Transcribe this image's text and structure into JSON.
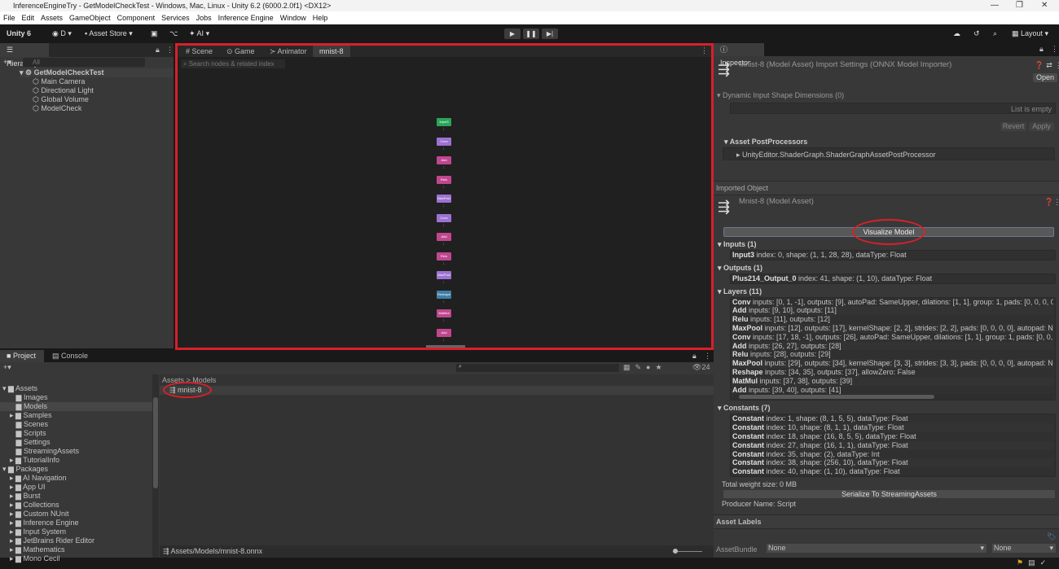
{
  "window": {
    "title": "InferenceEngineTry - GetModelCheckTest - Windows, Mac, Linux - Unity 6.2 (6000.2.0f1) <DX12>"
  },
  "menu": [
    "File",
    "Edit",
    "Assets",
    "GameObject",
    "Component",
    "Services",
    "Jobs",
    "Inference Engine",
    "Window",
    "Help"
  ],
  "toolbar": {
    "unity": "Unity 6",
    "account": "D",
    "asset_store": "Asset Store",
    "ai": "AI",
    "layout": "Layout"
  },
  "hierarchy": {
    "tab": "Hierarchy",
    "search_placeholder": "All",
    "scene": "GetModelCheckTest",
    "objects": [
      "Main Camera",
      "Directional Light",
      "Global Volume",
      "ModelCheck"
    ]
  },
  "center": {
    "tabs": [
      "Scene",
      "Game",
      "Animator",
      "mnist-8"
    ],
    "search_placeholder": "Search nodes & related index",
    "nodes": [
      {
        "label": "Input3",
        "type": "input"
      },
      {
        "label": "Conv",
        "type": "conv"
      },
      {
        "label": "Add",
        "type": "op"
      },
      {
        "label": "Relu",
        "type": "op"
      },
      {
        "label": "MaxPool",
        "type": "conv"
      },
      {
        "label": "Conv",
        "type": "conv"
      },
      {
        "label": "Add",
        "type": "op"
      },
      {
        "label": "Relu",
        "type": "op"
      },
      {
        "label": "MaxPool",
        "type": "conv"
      },
      {
        "label": "Reshape",
        "type": "reshape"
      },
      {
        "label": "MatMul",
        "type": "op"
      },
      {
        "label": "Add",
        "type": "op"
      }
    ],
    "node_colors": {
      "input": "#2aa55a",
      "conv": "#9c72d2",
      "op": "#c0468f",
      "reshape": "#3e7ea6"
    }
  },
  "project": {
    "tabs": [
      "Project",
      "Console"
    ],
    "assets_label": "Assets",
    "asset_folders": [
      "Images",
      "Models",
      "Samples",
      "Scenes",
      "Scripts",
      "Settings",
      "StreamingAssets",
      "TutorialInfo"
    ],
    "packages_label": "Packages",
    "packages": [
      "AI Navigation",
      "App UI",
      "Burst",
      "Collections",
      "Custom NUnit",
      "Inference Engine",
      "Input System",
      "JetBrains Rider Editor",
      "Mathematics",
      "Mono Cecil"
    ],
    "breadcrumb": "Assets > Models",
    "file": "mnist-8",
    "path": "Assets/Models/mnist-8.onnx",
    "count": "24"
  },
  "inspector": {
    "tab": "Inspector",
    "title": "Mnist-8 (Model Asset) Import Settings (ONNX Model Importer)",
    "open": "Open",
    "dynamic": "Dynamic Input Shape Dimensions (0)",
    "list_empty": "List is empty",
    "revert": "Revert",
    "apply": "Apply",
    "postprocessors": "Asset PostProcessors",
    "postprocessor_item": "UnityEditor.ShaderGraph.ShaderGraphAssetPostProcessor",
    "imported": "Imported Object",
    "asset_title": "Mnist-8 (Model Asset)",
    "visualize": "Visualize Model",
    "inputs_hdr": "Inputs (1)",
    "inputs": [
      {
        "name": "Input3",
        "desc": " index: 0, shape: (1, 1, 28, 28), dataType: Float"
      }
    ],
    "outputs_hdr": "Outputs (1)",
    "outputs": [
      {
        "name": "Plus214_Output_0",
        "desc": " index: 41, shape: (1, 10), dataType: Float"
      }
    ],
    "layers_hdr": "Layers (11)",
    "layers": [
      {
        "name": "Conv",
        "desc": " inputs: [0, 1, -1], outputs: [9], autoPad: SameUpper, dilations: [1, 1], group: 1, pads: [0, 0, 0, 0, 0, 0,"
      },
      {
        "name": "Add",
        "desc": " inputs: [9, 10], outputs: [11]"
      },
      {
        "name": "Relu",
        "desc": " inputs: [11], outputs: [12]"
      },
      {
        "name": "MaxPool",
        "desc": " inputs: [12], outputs: [17], kernelShape: [2, 2], strides: [2, 2], pads: [0, 0, 0, 0], autopad: NotSet"
      },
      {
        "name": "Conv",
        "desc": " inputs: [17, 18, -1], outputs: [26], autoPad: SameUpper, dilations: [1, 1], group: 1, pads: [0, 0, 0, 0, 0"
      },
      {
        "name": "Add",
        "desc": " inputs: [26, 27], outputs: [28]"
      },
      {
        "name": "Relu",
        "desc": " inputs: [28], outputs: [29]"
      },
      {
        "name": "MaxPool",
        "desc": " inputs: [29], outputs: [34], kernelShape: [3, 3], strides: [3, 3], pads: [0, 0, 0, 0], autopad: NotSet"
      },
      {
        "name": "Reshape",
        "desc": " inputs: [34, 35], outputs: [37], allowZero: False"
      },
      {
        "name": "MatMul",
        "desc": " inputs: [37, 38], outputs: [39]"
      },
      {
        "name": "Add",
        "desc": " inputs: [39, 40], outputs: [41]"
      }
    ],
    "constants_hdr": "Constants (7)",
    "constants": [
      {
        "name": "Constant",
        "desc": " index: 1, shape: (8, 1, 5, 5), dataType: Float"
      },
      {
        "name": "Constant",
        "desc": " index: 10, shape: (8, 1, 1), dataType: Float"
      },
      {
        "name": "Constant",
        "desc": " index: 18, shape: (16, 8, 5, 5), dataType: Float"
      },
      {
        "name": "Constant",
        "desc": " index: 27, shape: (16, 1, 1), dataType: Float"
      },
      {
        "name": "Constant",
        "desc": " index: 35, shape: (2), dataType: Int"
      },
      {
        "name": "Constant",
        "desc": " index: 38, shape: (256, 10), dataType: Float"
      },
      {
        "name": "Constant",
        "desc": " index: 40, shape: (1, 10), dataType: Float"
      }
    ],
    "weight": "Total weight size: 0 MB",
    "serialize": "Serialize To StreamingAssets",
    "producer": "Producer Name: Script",
    "labels": "Asset Labels",
    "bundle_label": "AssetBundle",
    "bundle": "None",
    "variant": "None"
  }
}
